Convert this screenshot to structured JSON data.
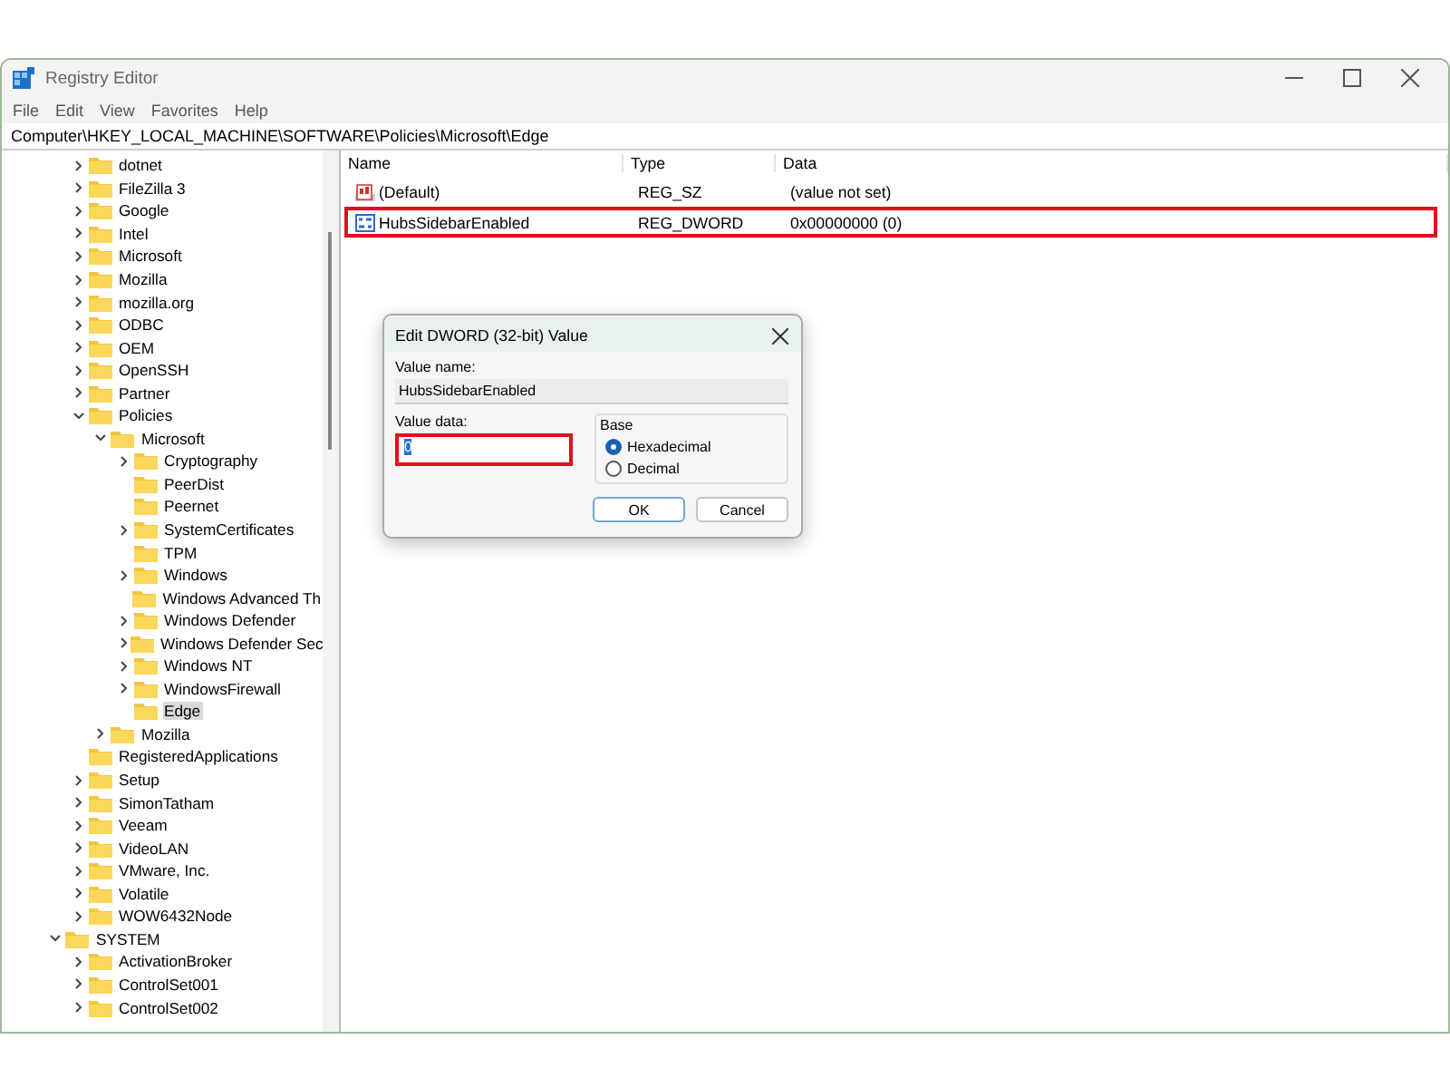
{
  "window": {
    "title": "Registry Editor"
  },
  "menu": [
    "File",
    "Edit",
    "View",
    "Favorites",
    "Help"
  ],
  "address": "Computer\\HKEY_LOCAL_MACHINE\\SOFTWARE\\Policies\\Microsoft\\Edge",
  "tree": [
    {
      "children": [
        {
          "label": "dotnet",
          "expandable": true,
          "expanded": false,
          "selected": false
        },
        {
          "label": "FileZilla 3",
          "expandable": true,
          "expanded": false,
          "selected": false
        },
        {
          "label": "Google",
          "expandable": true,
          "expanded": false,
          "selected": false
        },
        {
          "label": "Intel",
          "expandable": true,
          "expanded": false,
          "selected": false
        },
        {
          "label": "Microsoft",
          "expandable": true,
          "expanded": false,
          "selected": false
        },
        {
          "label": "Mozilla",
          "expandable": true,
          "expanded": false,
          "selected": false
        },
        {
          "label": "mozilla.org",
          "expandable": true,
          "expanded": false,
          "selected": false
        },
        {
          "label": "ODBC",
          "expandable": true,
          "expanded": false,
          "selected": false
        },
        {
          "label": "OEM",
          "expandable": true,
          "expanded": false,
          "selected": false
        },
        {
          "label": "OpenSSH",
          "expandable": true,
          "expanded": false,
          "selected": false
        },
        {
          "label": "Partner",
          "expandable": true,
          "expanded": false,
          "selected": false
        },
        {
          "label": "Policies",
          "expandable": true,
          "expanded": true,
          "selected": false,
          "children": [
            {
              "label": "Microsoft",
              "expandable": true,
              "expanded": true,
              "selected": false,
              "children": [
                {
                  "label": "Cryptography",
                  "expandable": true,
                  "expanded": false,
                  "selected": false
                },
                {
                  "label": "PeerDist",
                  "expandable": false,
                  "selected": false
                },
                {
                  "label": "Peernet",
                  "expandable": false,
                  "selected": false
                },
                {
                  "label": "SystemCertificates",
                  "expandable": true,
                  "expanded": false,
                  "selected": false
                },
                {
                  "label": "TPM",
                  "expandable": false,
                  "selected": false
                },
                {
                  "label": "Windows",
                  "expandable": true,
                  "expanded": false,
                  "selected": false
                },
                {
                  "label": "Windows Advanced Th",
                  "expandable": false,
                  "selected": false
                },
                {
                  "label": "Windows Defender",
                  "expandable": true,
                  "expanded": false,
                  "selected": false
                },
                {
                  "label": "Windows Defender Sec",
                  "expandable": true,
                  "expanded": false,
                  "selected": false
                },
                {
                  "label": "Windows NT",
                  "expandable": true,
                  "expanded": false,
                  "selected": false
                },
                {
                  "label": "WindowsFirewall",
                  "expandable": true,
                  "expanded": false,
                  "selected": false
                },
                {
                  "label": "Edge",
                  "expandable": false,
                  "selected": true
                }
              ]
            },
            {
              "label": "Mozilla",
              "expandable": true,
              "expanded": false,
              "selected": false
            }
          ]
        },
        {
          "label": "RegisteredApplications",
          "expandable": false,
          "selected": false
        },
        {
          "label": "Setup",
          "expandable": true,
          "expanded": false,
          "selected": false
        },
        {
          "label": "SimonTatham",
          "expandable": true,
          "expanded": false,
          "selected": false
        },
        {
          "label": "Veeam",
          "expandable": true,
          "expanded": false,
          "selected": false
        },
        {
          "label": "VideoLAN",
          "expandable": true,
          "expanded": false,
          "selected": false
        },
        {
          "label": "VMware, Inc.",
          "expandable": true,
          "expanded": false,
          "selected": false
        },
        {
          "label": "Volatile",
          "expandable": true,
          "expanded": false,
          "selected": false
        },
        {
          "label": "WOW6432Node",
          "expandable": true,
          "expanded": false,
          "selected": false
        }
      ]
    },
    {
      "label": "SYSTEM",
      "expandable": true,
      "expanded": true,
      "selected": false,
      "children": [
        {
          "label": "ActivationBroker",
          "expandable": true,
          "expanded": false,
          "selected": false
        },
        {
          "label": "ControlSet001",
          "expandable": true,
          "expanded": false,
          "selected": false
        },
        {
          "label": "ControlSet002",
          "expandable": true,
          "expanded": false,
          "selected": false
        }
      ]
    }
  ],
  "values_table": {
    "columns": [
      "Name",
      "Type",
      "Data"
    ],
    "rows": [
      {
        "kind": "string",
        "name": "(Default)",
        "type": "REG_SZ",
        "data": "(value not set)",
        "highlighted": false
      },
      {
        "kind": "binary",
        "name": "HubsSidebarEnabled",
        "type": "REG_DWORD",
        "data": "0x00000000 (0)",
        "highlighted": true
      }
    ]
  },
  "dialog": {
    "title": "Edit DWORD (32-bit) Value",
    "value_name_label": "Value name:",
    "value_name": "HubsSidebarEnabled",
    "value_data_label": "Value data:",
    "value_data": "0",
    "value_data_highlighted": true,
    "base_label": "Base",
    "base_options": [
      {
        "label": "Hexadecimal",
        "selected": true
      },
      {
        "label": "Decimal",
        "selected": false
      }
    ],
    "buttons": [
      "OK",
      "Cancel"
    ]
  }
}
